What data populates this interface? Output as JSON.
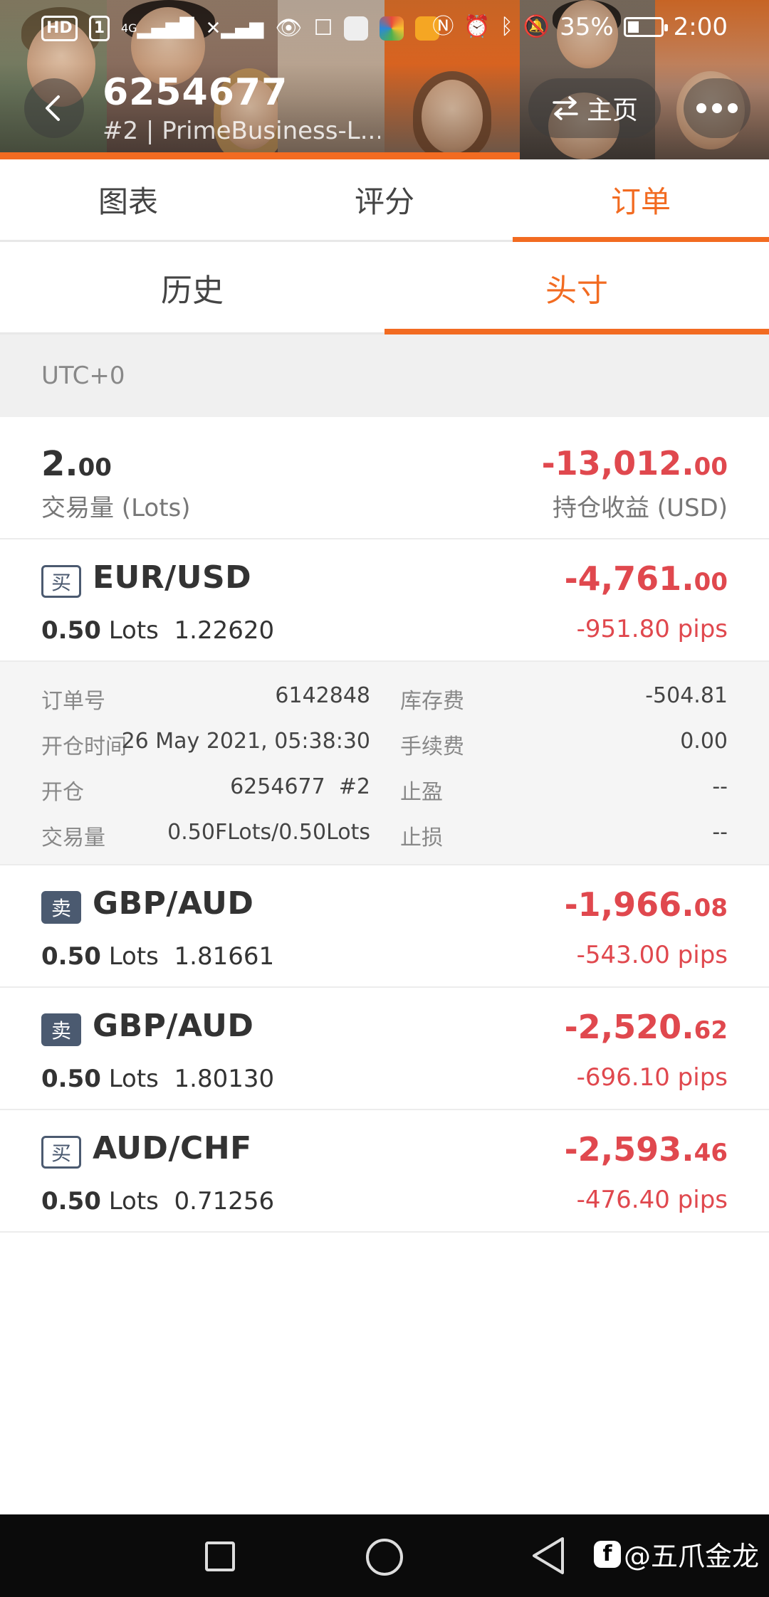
{
  "status_bar": {
    "left_badges": [
      "HD",
      "1"
    ],
    "signal_label": "4G",
    "battery": "35%",
    "battery_level": 0.35,
    "time": "2:00"
  },
  "header": {
    "title": "6254677",
    "subtitle": "#2 | PrimeBusiness-L...",
    "home_label": "主页"
  },
  "tabs": [
    {
      "label": "图表",
      "active": false
    },
    {
      "label": "评分",
      "active": false
    },
    {
      "label": "订单",
      "active": true
    }
  ],
  "subtabs": [
    {
      "label": "历史",
      "active": false
    },
    {
      "label": "头寸",
      "active": true
    }
  ],
  "timezone": "UTC+0",
  "summary": {
    "volume_int": "2.",
    "volume_dec": "00",
    "volume_label": "交易量 (Lots)",
    "pnl_int": "-13,012.",
    "pnl_dec": "00",
    "pnl_label": "持仓收益 (USD)"
  },
  "positions": [
    {
      "side": "买",
      "side_type": "buy",
      "symbol": "EUR/USD",
      "lots": "0.50",
      "lots_unit": "Lots",
      "price": "1.22620",
      "pnl_int": "-4,761.",
      "pnl_dec": "00",
      "pips": "-951.80 pips"
    },
    {
      "side": "卖",
      "side_type": "sell",
      "symbol": "GBP/AUD",
      "lots": "0.50",
      "lots_unit": "Lots",
      "price": "1.81661",
      "pnl_int": "-1,966.",
      "pnl_dec": "08",
      "pips": "-543.00 pips"
    },
    {
      "side": "卖",
      "side_type": "sell",
      "symbol": "GBP/AUD",
      "lots": "0.50",
      "lots_unit": "Lots",
      "price": "1.80130",
      "pnl_int": "-2,520.",
      "pnl_dec": "62",
      "pips": "-696.10 pips"
    },
    {
      "side": "买",
      "side_type": "buy",
      "symbol": "AUD/CHF",
      "lots": "0.50",
      "lots_unit": "Lots",
      "price": "0.71256",
      "pnl_int": "-2,593.",
      "pnl_dec": "46",
      "pips": "-476.40 pips"
    }
  ],
  "detail": {
    "order_no_label": "订单号",
    "order_no": "6142848",
    "swap_label": "库存费",
    "swap": "-504.81",
    "open_time_label": "开仓时间",
    "open_time": "26 May 2021, 05:38:30",
    "commission_label": "手续费",
    "commission": "0.00",
    "open_label": "开仓",
    "open": "6254677  #2",
    "tp_label": "止盈",
    "tp": "--",
    "volume_label": "交易量",
    "volume": "0.50FLots/0.50Lots",
    "sl_label": "止损",
    "sl": "--"
  },
  "watermark": "@五爪金龙",
  "colors": {
    "accent": "#f26b21",
    "loss": "#e0484e",
    "badge": "#4b5a70"
  }
}
